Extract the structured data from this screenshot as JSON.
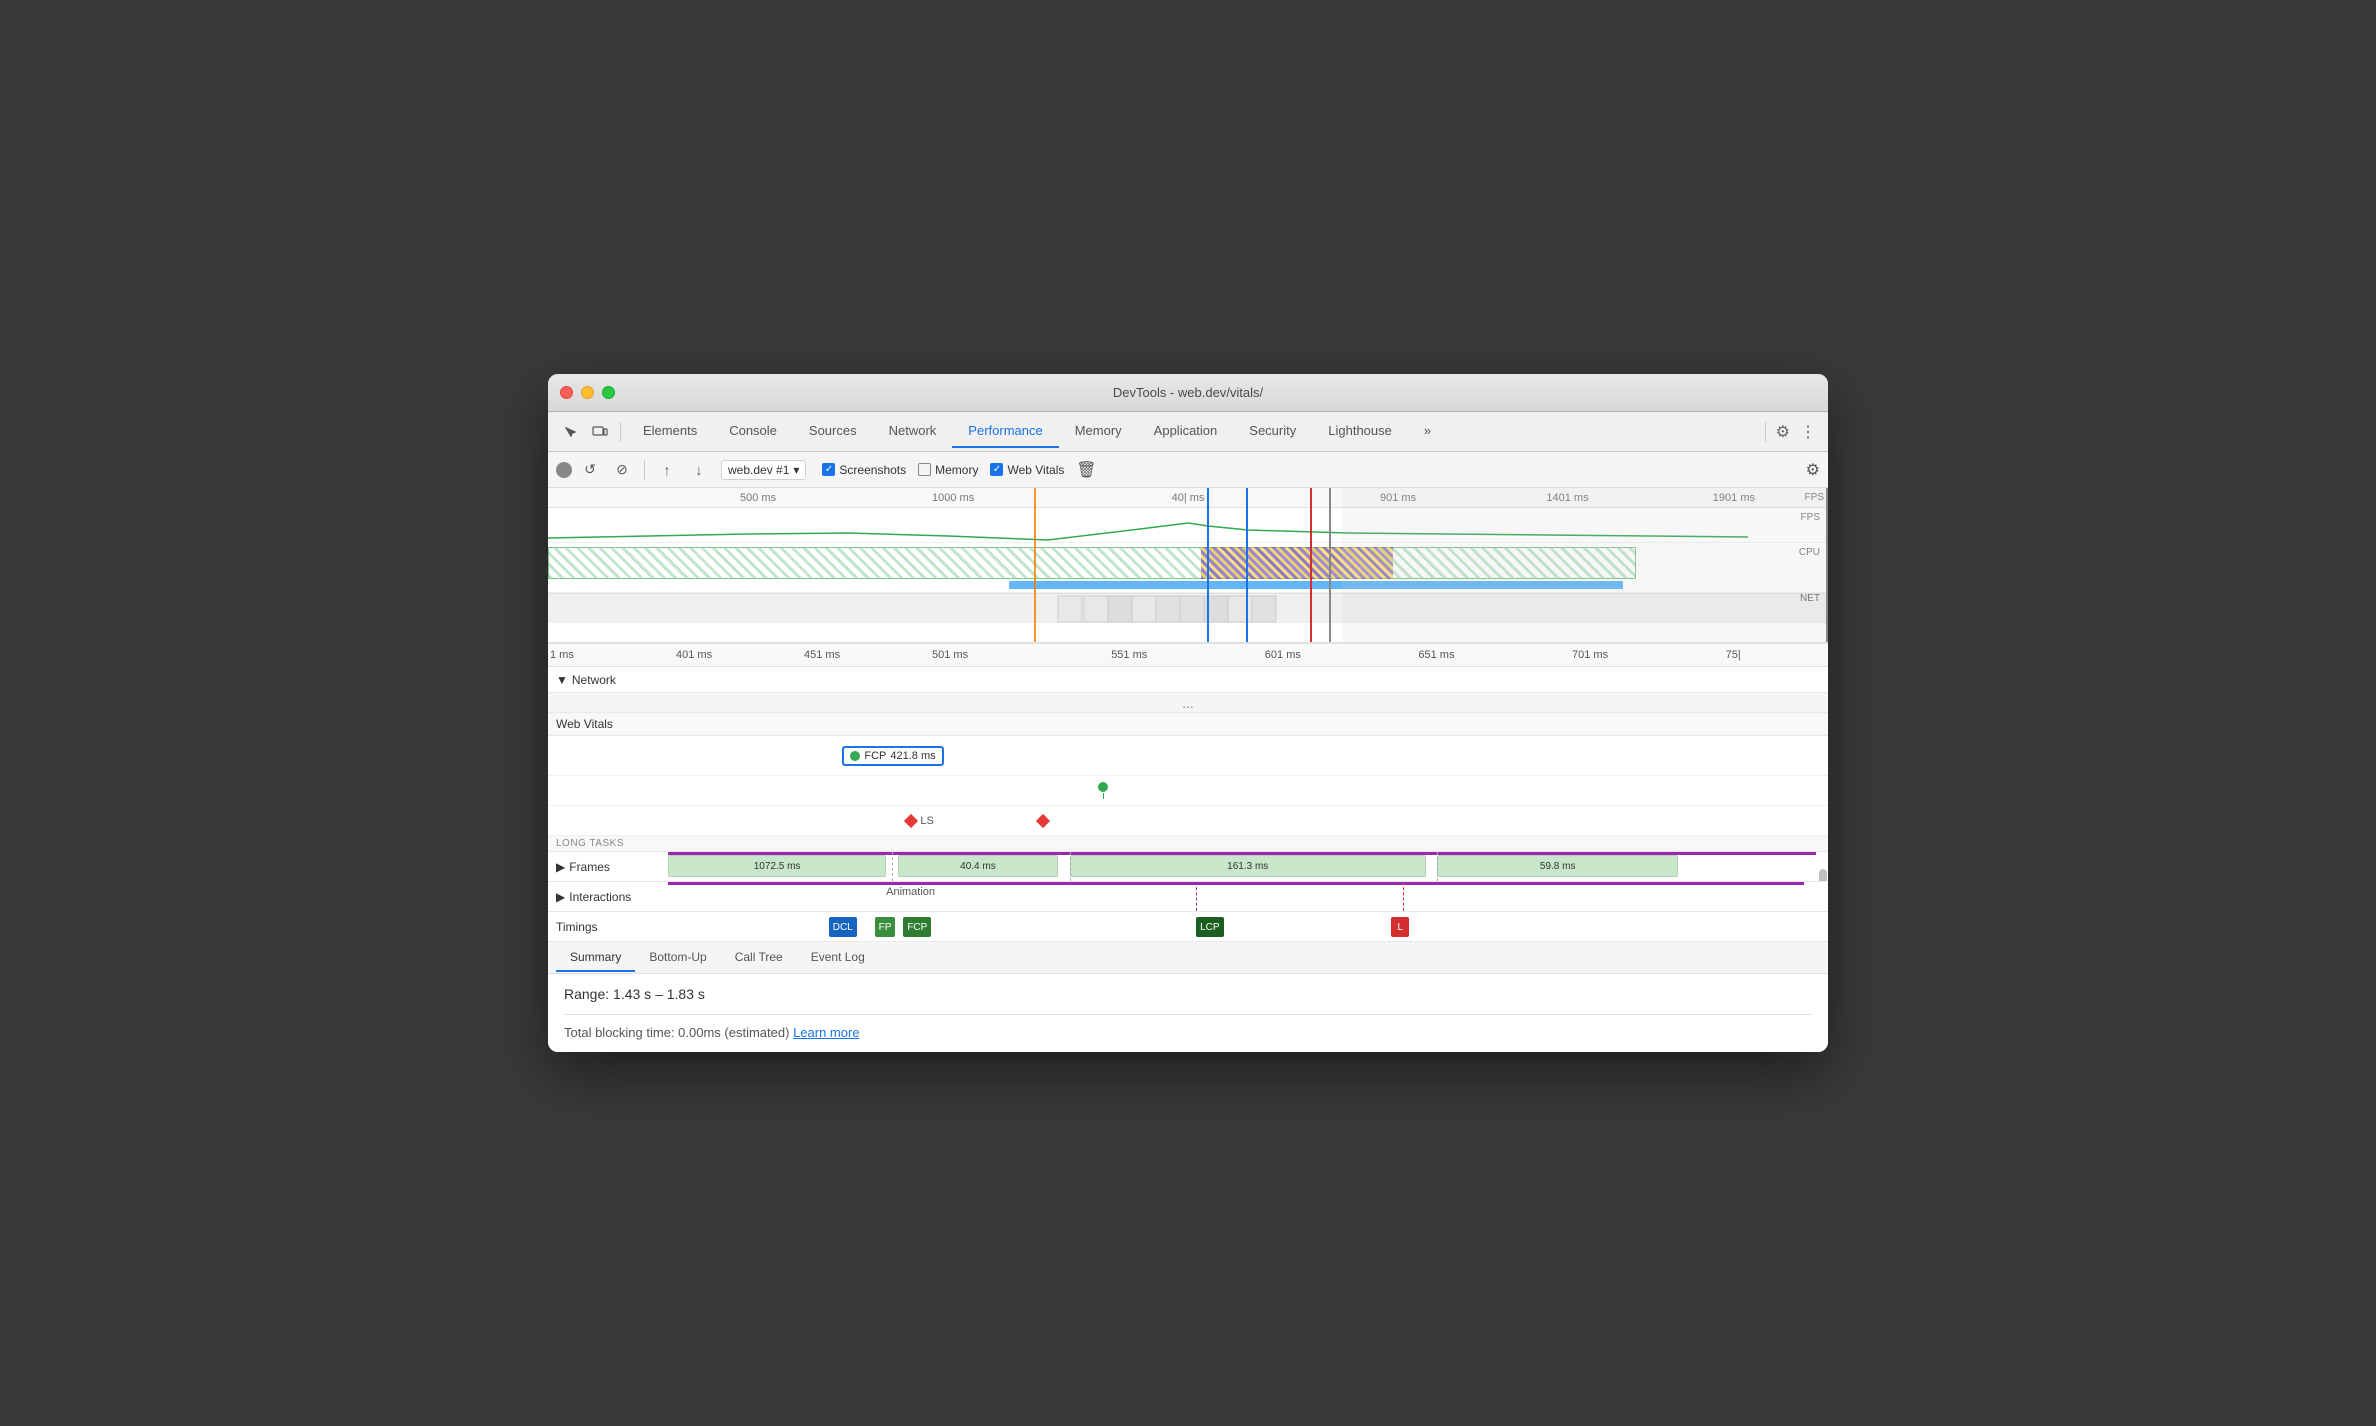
{
  "window": {
    "title": "DevTools - web.dev/vitals/"
  },
  "toolbar": {
    "tabs": [
      {
        "id": "elements",
        "label": "Elements",
        "active": false
      },
      {
        "id": "console",
        "label": "Console",
        "active": false
      },
      {
        "id": "sources",
        "label": "Sources",
        "active": false
      },
      {
        "id": "network",
        "label": "Network",
        "active": false
      },
      {
        "id": "performance",
        "label": "Performance",
        "active": true
      },
      {
        "id": "memory",
        "label": "Memory",
        "active": false
      },
      {
        "id": "application",
        "label": "Application",
        "active": false
      },
      {
        "id": "security",
        "label": "Security",
        "active": false
      },
      {
        "id": "lighthouse",
        "label": "Lighthouse",
        "active": false
      }
    ],
    "more_tabs": "»",
    "gear": "⚙",
    "dots": "⋮"
  },
  "second_toolbar": {
    "record_label": "●",
    "refresh_label": "↺",
    "stop_label": "⊘",
    "upload_label": "↑",
    "download_label": "↓",
    "session": "web.dev #1",
    "screenshots_label": "Screenshots",
    "screenshots_checked": true,
    "memory_label": "Memory",
    "memory_checked": false,
    "web_vitals_label": "Web Vitals",
    "web_vitals_checked": true,
    "trash_label": "🗑",
    "settings_label": "⚙"
  },
  "timeline_ruler_top": {
    "marks": [
      "500 ms",
      "1000 ms",
      "40| ms",
      "901 ms",
      "1401 ms",
      "1901 ms"
    ]
  },
  "timeline_ruler_bottom": {
    "marks": [
      "1 ms",
      "401 ms",
      "451 ms",
      "501 ms",
      "551 ms",
      "601 ms",
      "651 ms",
      "701 ms",
      "75|"
    ]
  },
  "track_labels": {
    "fps": "FPS",
    "cpu": "CPU",
    "net": "NET"
  },
  "network_row": {
    "label": "▼ Network"
  },
  "more_dots": "...",
  "web_vitals": {
    "section_label": "Web Vitals",
    "fcp": {
      "label": "FCP",
      "value": "421.8 ms"
    },
    "ls_label": "LS",
    "long_tasks_label": "LONG TASKS"
  },
  "frames": {
    "label": "Frames",
    "toggle": "▶",
    "blocks": [
      {
        "text": "1072.5 ms",
        "color": "#c8e6c9",
        "left": "0%",
        "width": "20%"
      },
      {
        "text": "40.4 ms",
        "color": "#c8e6c9",
        "left": "20.5%",
        "width": "15%"
      },
      {
        "text": "161.3 ms",
        "color": "#c8e6c9",
        "left": "36%",
        "width": "32%"
      },
      {
        "text": "59.8 ms",
        "color": "#c8e6c9",
        "left": "69%",
        "width": "22%"
      }
    ]
  },
  "interactions": {
    "label": "Interactions",
    "toggle": "▶",
    "animation_label": "Animation"
  },
  "timings": {
    "label": "Timings",
    "dcl": {
      "label": "DCL",
      "color": "#1565c0",
      "left": "14%"
    },
    "fp": {
      "label": "FP",
      "color": "#388e3c",
      "left": "18.5%"
    },
    "fcp": {
      "label": "FCP",
      "color": "#2e7d32",
      "left": "20%"
    },
    "lcp": {
      "label": "LCP",
      "color": "#1b5e20",
      "left": "46%"
    },
    "l": {
      "label": "L",
      "color": "#c62828",
      "left": "63%"
    }
  },
  "bottom_tabs": [
    {
      "id": "summary",
      "label": "Summary",
      "active": true
    },
    {
      "id": "bottomup",
      "label": "Bottom-Up",
      "active": false
    },
    {
      "id": "calltree",
      "label": "Call Tree",
      "active": false
    },
    {
      "id": "eventlog",
      "label": "Event Log",
      "active": false
    }
  ],
  "summary": {
    "range_label": "Range:",
    "range_value": "1.43 s – 1.83 s",
    "blocking_time_label": "Total blocking time: 0.00ms (estimated)",
    "learn_more": "Learn more"
  }
}
